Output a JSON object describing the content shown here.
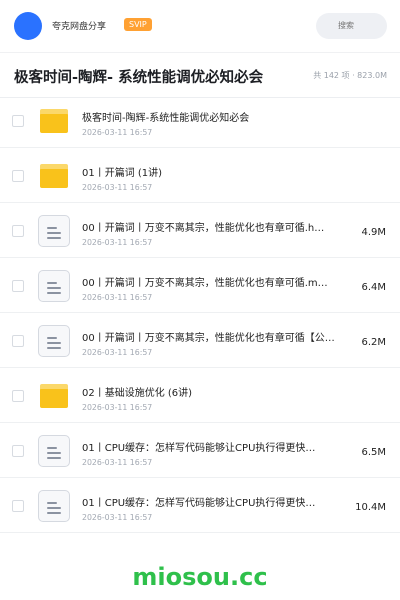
{
  "header": {
    "share_name": "夸克网盘分享",
    "badge": "SVIP",
    "search_placeholder": "搜索"
  },
  "folder": {
    "title": "极客时间-陶辉- 系统性能调优必知必会",
    "meta": "共 142 项 · 823.0M"
  },
  "files": [
    {
      "type": "folder",
      "name": "极客时间-陶辉-系统性能调优必知必会",
      "date": "2026-03-11 16:57",
      "size": ""
    },
    {
      "type": "folder",
      "name": "01丨开篇词 (1讲)",
      "date": "2026-03-11 16:57",
      "size": ""
    },
    {
      "type": "file",
      "name": "00丨开篇词丨万变不离其宗，性能优化也有章可循.h…",
      "date": "2026-03-11 16:57",
      "size": "4.9M"
    },
    {
      "type": "file",
      "name": "00丨开篇词丨万变不离其宗，性能优化也有章可循.m…",
      "date": "2026-03-11 16:57",
      "size": "6.4M"
    },
    {
      "type": "file",
      "name": "00丨开篇词丨万变不离其宗，性能优化也有章可循【公…",
      "date": "2026-03-11 16:57",
      "size": "6.2M"
    },
    {
      "type": "folder",
      "name": "02丨基础设施优化 (6讲)",
      "date": "2026-03-11 16:57",
      "size": ""
    },
    {
      "type": "file",
      "name": "01丨CPU缓存：怎样写代码能够让CPU执行得更快…",
      "date": "2026-03-11 16:57",
      "size": "6.5M"
    },
    {
      "type": "file",
      "name": "01丨CPU缓存：怎样写代码能够让CPU执行得更快…",
      "date": "2026-03-11 16:57",
      "size": "10.4M"
    }
  ],
  "watermark": "miosou.cc",
  "colors": {
    "accent": "#2a72ff",
    "svip": "#ffa133",
    "folder": "#f9c21b",
    "watermark": "#2fc04b"
  }
}
